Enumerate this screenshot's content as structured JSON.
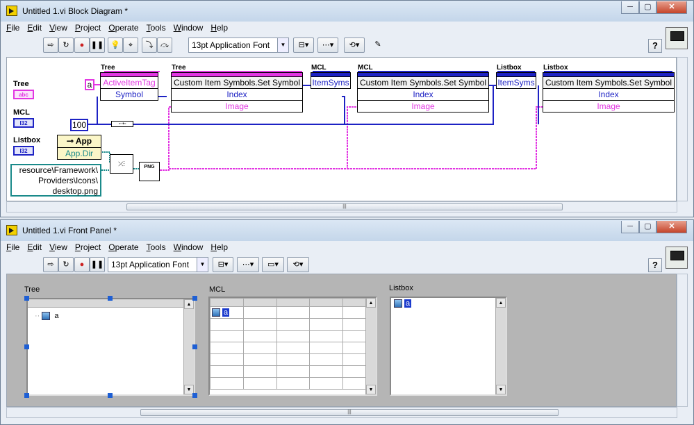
{
  "block_diagram": {
    "title": "Untitled 1.vi Block Diagram *",
    "menu": [
      "File",
      "Edit",
      "View",
      "Project",
      "Operate",
      "Tools",
      "Window",
      "Help"
    ],
    "font_select": "13pt Application Font",
    "help": "?",
    "terminals": {
      "tree_label": "Tree",
      "tree_type": "abc",
      "mcl_label": "MCL",
      "mcl_type": "I32",
      "listbox_label": "Listbox",
      "listbox_type": "I32"
    },
    "constants": {
      "a": "a",
      "index": "100",
      "path_line1": "resource\\Framework\\",
      "path_line2": "Providers\\Icons\\",
      "path_line3": "desktop.png",
      "png_label": "PNG"
    },
    "app_node": {
      "header": "App",
      "property": "App.Dir"
    },
    "tree_prop_node": {
      "label": "Tree",
      "row1": "ActiveItemTag",
      "row2": "Symbol"
    },
    "tree_invoke_node": {
      "label": "Tree",
      "method": "Custom Item Symbols.Set Symbol",
      "row1": "Index",
      "row2": "Image"
    },
    "mcl_prop_node": {
      "label": "MCL",
      "row1": "ItemSyms"
    },
    "mcl_invoke_node": {
      "label": "MCL",
      "method": "Custom Item Symbols.Set Symbol",
      "row1": "Index",
      "row2": "Image"
    },
    "listbox_prop_node": {
      "label": "Listbox",
      "row1": "ItemSyms"
    },
    "listbox_invoke_node": {
      "label": "Listbox",
      "method": "Custom Item Symbols.Set Symbol",
      "row1": "Index",
      "row2": "Image"
    },
    "colors": {
      "pink": "#e236e2",
      "blue": "#1d22c4",
      "teal": "#1a8a8a"
    }
  },
  "front_panel": {
    "title": "Untitled 1.vi Front Panel *",
    "menu": [
      "File",
      "Edit",
      "View",
      "Project",
      "Operate",
      "Tools",
      "Window",
      "Help"
    ],
    "font_select": "13pt Application Font",
    "help": "?",
    "tree": {
      "label": "Tree",
      "item": "a"
    },
    "mcl": {
      "label": "MCL",
      "item": "a"
    },
    "listbox": {
      "label": "Listbox",
      "item": "a"
    }
  }
}
